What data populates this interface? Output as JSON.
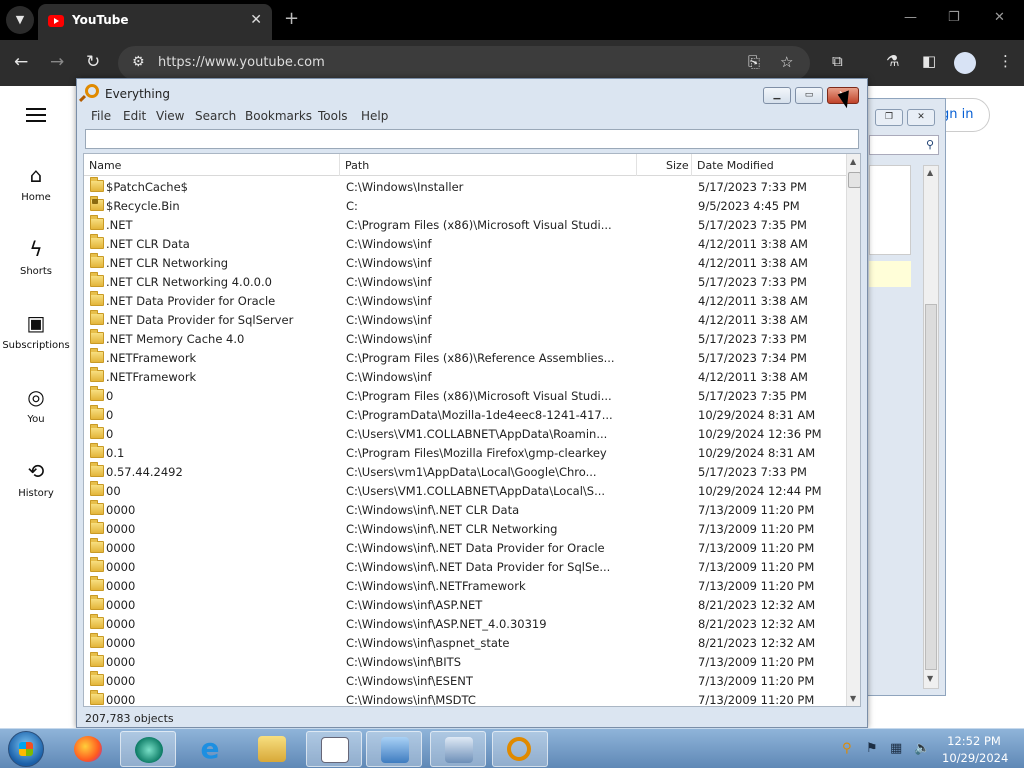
{
  "browser": {
    "tab_title": "YouTube",
    "url": "https://www.youtube.com",
    "url_host": "www.youtube.com"
  },
  "youtube": {
    "sidebar": [
      {
        "label": "Home",
        "icon": "home-icon"
      },
      {
        "label": "Shorts",
        "icon": "shorts-icon"
      },
      {
        "label": "Subscriptions",
        "icon": "subscriptions-icon"
      },
      {
        "label": "You",
        "icon": "you-icon"
      },
      {
        "label": "History",
        "icon": "history-icon"
      }
    ],
    "signin_label": "gn in"
  },
  "everything": {
    "title": "Everything",
    "menu": [
      "File",
      "Edit",
      "View",
      "Search",
      "Bookmarks",
      "Tools",
      "Help"
    ],
    "search_value": "",
    "columns": {
      "name": "Name",
      "path": "Path",
      "size": "Size",
      "modified": "Date Modified"
    },
    "rows": [
      {
        "name": "$PatchCache$",
        "path": "C:\\Windows\\Installer",
        "modified": "5/17/2023 7:33 PM"
      },
      {
        "name": "$Recycle.Bin",
        "path": "C:",
        "modified": "9/5/2023 4:45 PM",
        "locked": true
      },
      {
        "name": ".NET",
        "path": "C:\\Program Files (x86)\\Microsoft Visual Studi...",
        "modified": "5/17/2023 7:35 PM"
      },
      {
        "name": ".NET CLR Data",
        "path": "C:\\Windows\\inf",
        "modified": "4/12/2011 3:38 AM"
      },
      {
        "name": ".NET CLR Networking",
        "path": "C:\\Windows\\inf",
        "modified": "4/12/2011 3:38 AM"
      },
      {
        "name": ".NET CLR Networking 4.0.0.0",
        "path": "C:\\Windows\\inf",
        "modified": "5/17/2023 7:33 PM"
      },
      {
        "name": ".NET Data Provider for Oracle",
        "path": "C:\\Windows\\inf",
        "modified": "4/12/2011 3:38 AM"
      },
      {
        "name": ".NET Data Provider for SqlServer",
        "path": "C:\\Windows\\inf",
        "modified": "4/12/2011 3:38 AM"
      },
      {
        "name": ".NET Memory Cache 4.0",
        "path": "C:\\Windows\\inf",
        "modified": "5/17/2023 7:33 PM"
      },
      {
        "name": ".NETFramework",
        "path": "C:\\Program Files (x86)\\Reference Assemblies...",
        "modified": "5/17/2023 7:34 PM"
      },
      {
        "name": ".NETFramework",
        "path": "C:\\Windows\\inf",
        "modified": "4/12/2011 3:38 AM"
      },
      {
        "name": "0",
        "path": "C:\\Program Files (x86)\\Microsoft Visual Studi...",
        "modified": "5/17/2023 7:35 PM"
      },
      {
        "name": "0",
        "path": "C:\\ProgramData\\Mozilla-1de4eec8-1241-417...",
        "modified": "10/29/2024 8:31 AM"
      },
      {
        "name": "0",
        "path": "C:\\Users\\VM1.COLLABNET\\AppData\\Roamin...",
        "modified": "10/29/2024 12:36 PM"
      },
      {
        "name": "0.1",
        "path": "C:\\Program Files\\Mozilla Firefox\\gmp-clearkey",
        "modified": "10/29/2024 8:31 AM"
      },
      {
        "name": "0.57.44.2492",
        "path": "C:\\Users\\vm1\\AppData\\Local\\Google\\Chro...",
        "modified": "5/17/2023 7:33 PM"
      },
      {
        "name": "00",
        "path": "C:\\Users\\VM1.COLLABNET\\AppData\\Local\\S...",
        "modified": "10/29/2024 12:44 PM"
      },
      {
        "name": "0000",
        "path": "C:\\Windows\\inf\\.NET CLR Data",
        "modified": "7/13/2009 11:20 PM"
      },
      {
        "name": "0000",
        "path": "C:\\Windows\\inf\\.NET CLR Networking",
        "modified": "7/13/2009 11:20 PM"
      },
      {
        "name": "0000",
        "path": "C:\\Windows\\inf\\.NET Data Provider for Oracle",
        "modified": "7/13/2009 11:20 PM"
      },
      {
        "name": "0000",
        "path": "C:\\Windows\\inf\\.NET Data Provider for SqlSe...",
        "modified": "7/13/2009 11:20 PM"
      },
      {
        "name": "0000",
        "path": "C:\\Windows\\inf\\.NETFramework",
        "modified": "7/13/2009 11:20 PM"
      },
      {
        "name": "0000",
        "path": "C:\\Windows\\inf\\ASP.NET",
        "modified": "8/21/2023 12:32 AM"
      },
      {
        "name": "0000",
        "path": "C:\\Windows\\inf\\ASP.NET_4.0.30319",
        "modified": "8/21/2023 12:32 AM"
      },
      {
        "name": "0000",
        "path": "C:\\Windows\\inf\\aspnet_state",
        "modified": "8/21/2023 12:32 AM"
      },
      {
        "name": "0000",
        "path": "C:\\Windows\\inf\\BITS",
        "modified": "7/13/2009 11:20 PM"
      },
      {
        "name": "0000",
        "path": "C:\\Windows\\inf\\ESENT",
        "modified": "7/13/2009 11:20 PM"
      },
      {
        "name": "0000",
        "path": "C:\\Windows\\inf\\MSDTC",
        "modified": "7/13/2009 11:20 PM"
      }
    ],
    "status": "207,783 objects"
  },
  "taskbar": {
    "time": "12:52 PM",
    "date": "10/29/2024",
    "apps": [
      "firefox",
      "app-green",
      "internet-explorer",
      "file-explorer",
      "document-app",
      "control-panel",
      "remote-desktop",
      "everything"
    ]
  }
}
